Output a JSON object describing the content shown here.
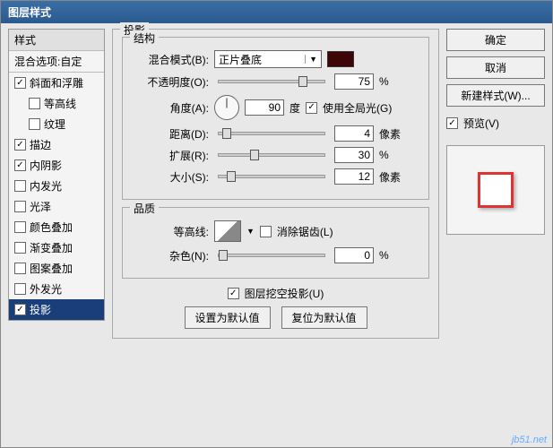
{
  "title": "图层样式",
  "sidebar": {
    "header": "样式",
    "blendRow": "混合选项:自定",
    "items": [
      {
        "label": "斜面和浮雕",
        "checked": true,
        "indent": false
      },
      {
        "label": "等高线",
        "checked": false,
        "indent": true
      },
      {
        "label": "纹理",
        "checked": false,
        "indent": true
      },
      {
        "label": "描边",
        "checked": true,
        "indent": false
      },
      {
        "label": "内阴影",
        "checked": true,
        "indent": false
      },
      {
        "label": "内发光",
        "checked": false,
        "indent": false
      },
      {
        "label": "光泽",
        "checked": false,
        "indent": false
      },
      {
        "label": "颜色叠加",
        "checked": false,
        "indent": false
      },
      {
        "label": "渐变叠加",
        "checked": false,
        "indent": false
      },
      {
        "label": "图案叠加",
        "checked": false,
        "indent": false
      },
      {
        "label": "外发光",
        "checked": false,
        "indent": false
      },
      {
        "label": "投影",
        "checked": true,
        "indent": false,
        "selected": true
      }
    ]
  },
  "panel": {
    "title": "投影",
    "structure": {
      "legend": "结构",
      "blendModeLabel": "混合模式(B):",
      "blendModeValue": "正片叠底",
      "swatchColor": "#3d0505",
      "opacityLabel": "不透明度(O):",
      "opacityValue": "75",
      "opacityUnit": "%",
      "angleLabel": "角度(A):",
      "angleValue": "90",
      "angleUnit": "度",
      "globalLightLabel": "使用全局光(G)",
      "globalLightChecked": true,
      "distanceLabel": "距离(D):",
      "distanceValue": "4",
      "distanceUnit": "像素",
      "spreadLabel": "扩展(R):",
      "spreadValue": "30",
      "spreadUnit": "%",
      "sizeLabel": "大小(S):",
      "sizeValue": "12",
      "sizeUnit": "像素"
    },
    "quality": {
      "legend": "品质",
      "contourLabel": "等高线:",
      "antialiasLabel": "消除锯齿(L)",
      "antialiasChecked": false,
      "noiseLabel": "杂色(N):",
      "noiseValue": "0",
      "noiseUnit": "%"
    },
    "knockoutLabel": "图层挖空投影(U)",
    "knockoutChecked": true,
    "setDefaultBtn": "设置为默认值",
    "resetDefaultBtn": "复位为默认值"
  },
  "buttons": {
    "ok": "确定",
    "cancel": "取消",
    "newStyle": "新建样式(W)...",
    "previewLabel": "预览(V)",
    "previewChecked": true
  },
  "watermark": "jb51.net"
}
